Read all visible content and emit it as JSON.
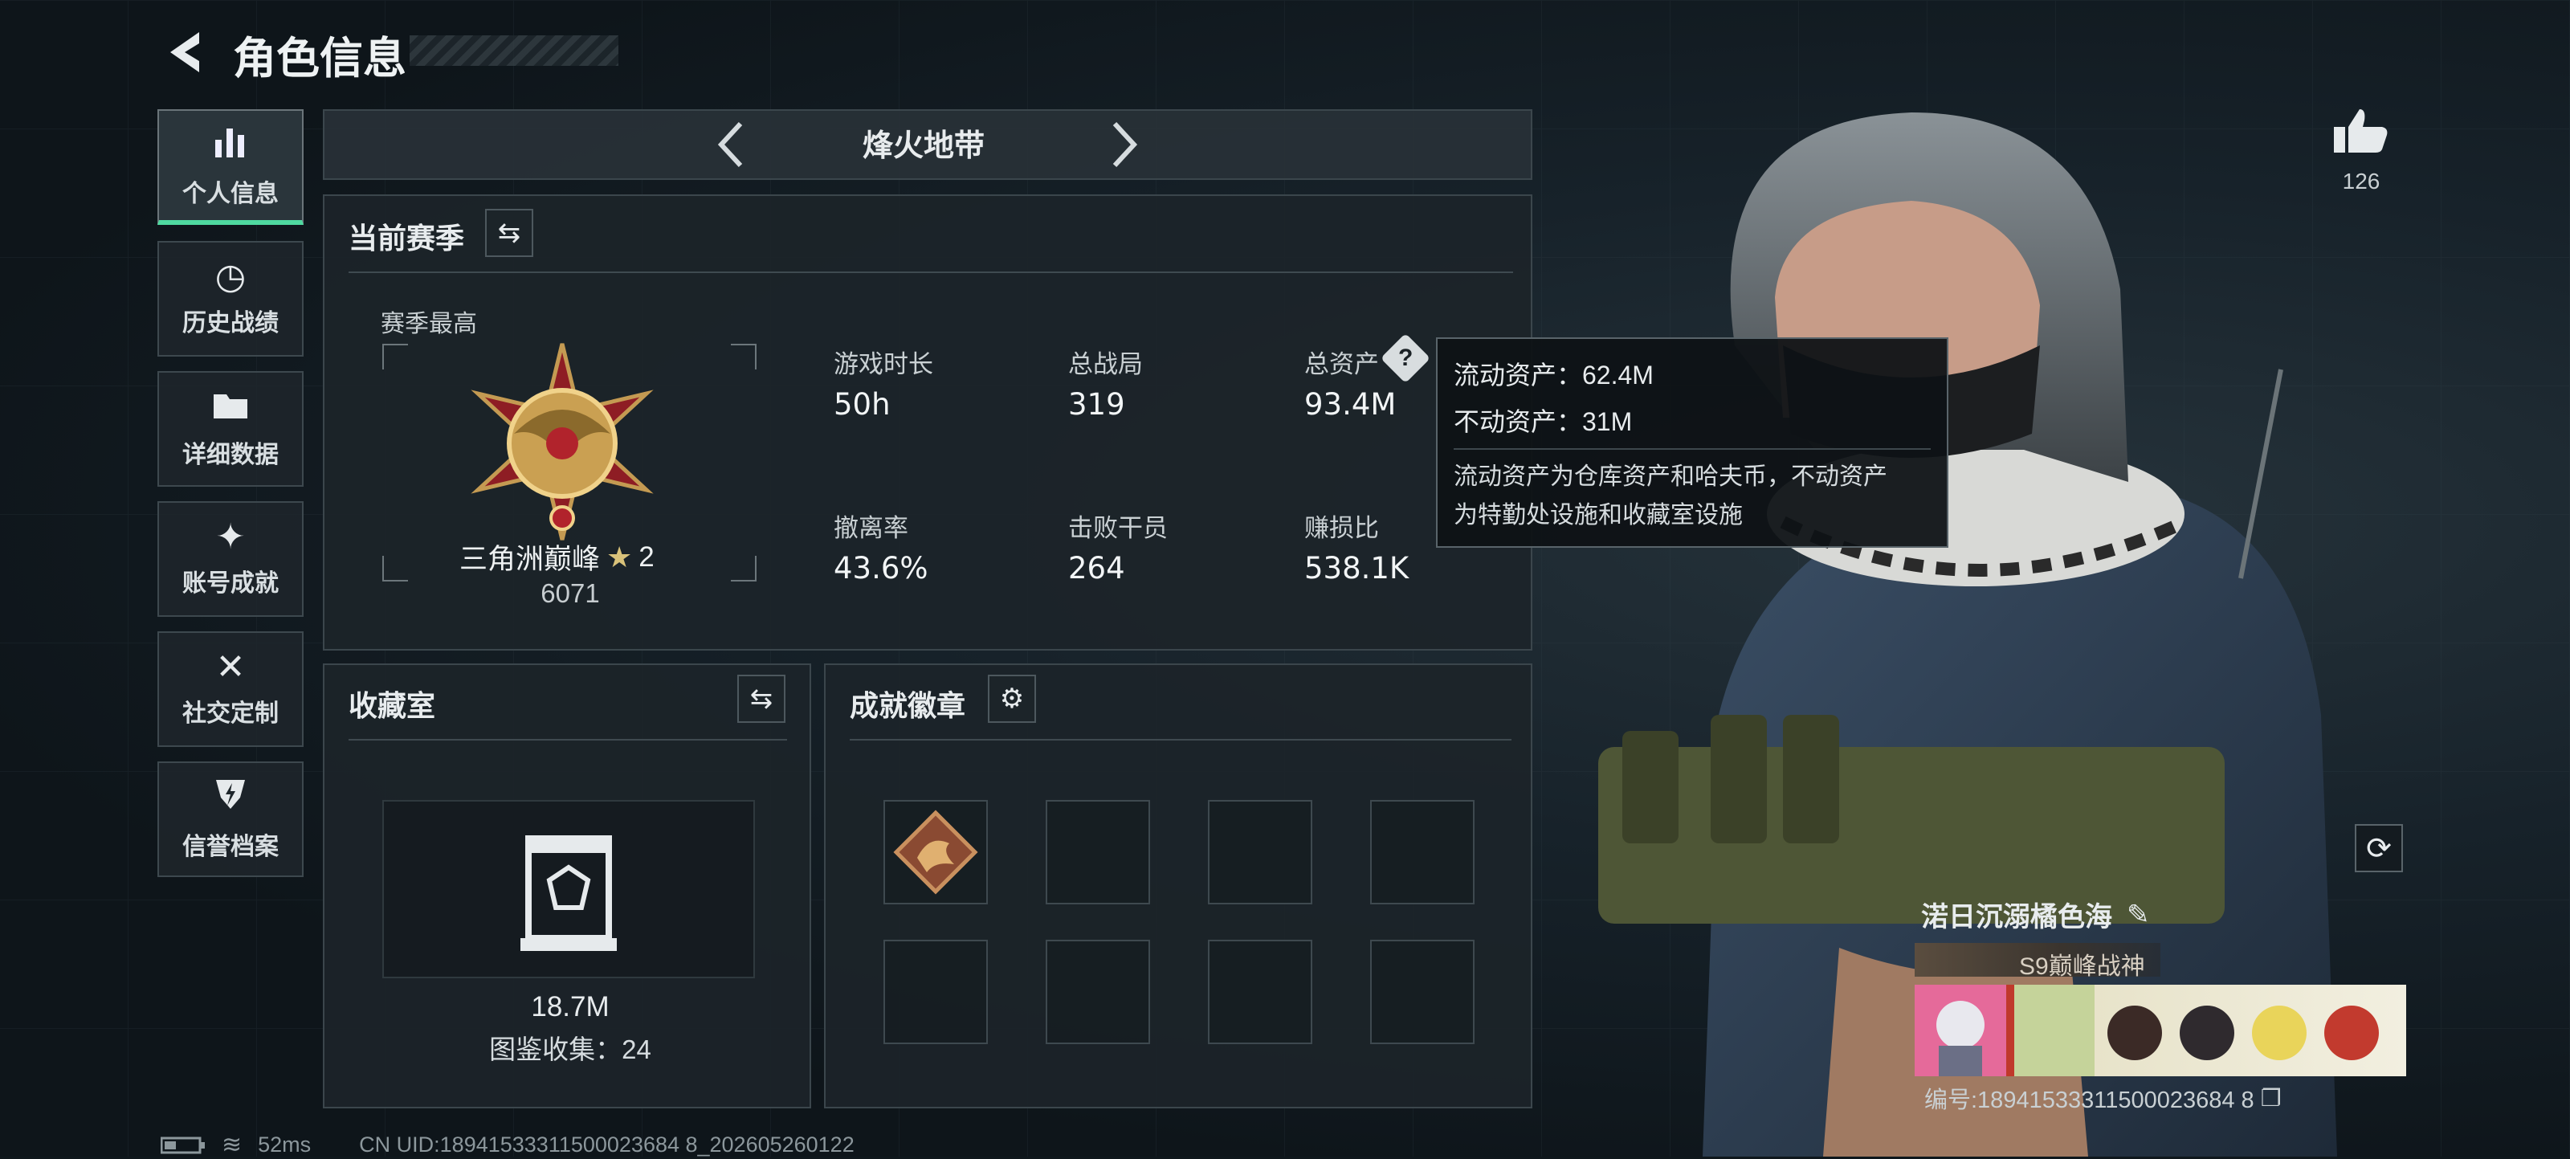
{
  "header": {
    "title": "角色信息"
  },
  "sidebar": {
    "items": [
      {
        "label": "个人信息",
        "icon": "bar-chart-icon"
      },
      {
        "label": "历史战绩",
        "icon": "history-clock-icon"
      },
      {
        "label": "详细数据",
        "icon": "folder-icon"
      },
      {
        "label": "账号成就",
        "icon": "achievement-gem-icon"
      },
      {
        "label": "社交定制",
        "icon": "tools-icon"
      },
      {
        "label": "信誉档案",
        "icon": "shield-lightning-icon"
      }
    ]
  },
  "mode_selector": {
    "label": "烽火地带"
  },
  "season": {
    "title": "当前赛季",
    "best_label": "赛季最高",
    "rank_name": "三角洲巅峰",
    "rank_stars": "2",
    "rank_score": "6071",
    "stats": [
      {
        "label": "游戏时长",
        "value": "50h"
      },
      {
        "label": "总战局",
        "value": "319"
      },
      {
        "label": "总资产",
        "value": "93.4M"
      },
      {
        "label": "撤离率",
        "value": "43.6%"
      },
      {
        "label": "击败干员",
        "value": "264"
      },
      {
        "label": "赚损比",
        "value": "538.1K"
      }
    ]
  },
  "tooltip": {
    "liquid": "流动资产：62.4M",
    "fixed": "不动资产：31M",
    "desc_line1": "流动资产为仓库资产和哈夫币，不动资产",
    "desc_line2": "为特勤处设施和收藏室设施"
  },
  "collection": {
    "title": "收藏室",
    "value": "18.7M",
    "count_label": "图鉴收集：24"
  },
  "badges": {
    "title": "成就徽章"
  },
  "likes": {
    "count": "126"
  },
  "profile": {
    "name": "渃日沉溺橘色海",
    "title_badge": "S9巅峰战神",
    "id_label": "编号:18941533311500023684 8"
  },
  "footer": {
    "ping": "52ms",
    "uid": "CN UID:18941533311500023684 8_202605260122"
  },
  "colors": {
    "accent": "#4fd9a0",
    "panel": "#1c2429",
    "border": "#3b464c"
  }
}
